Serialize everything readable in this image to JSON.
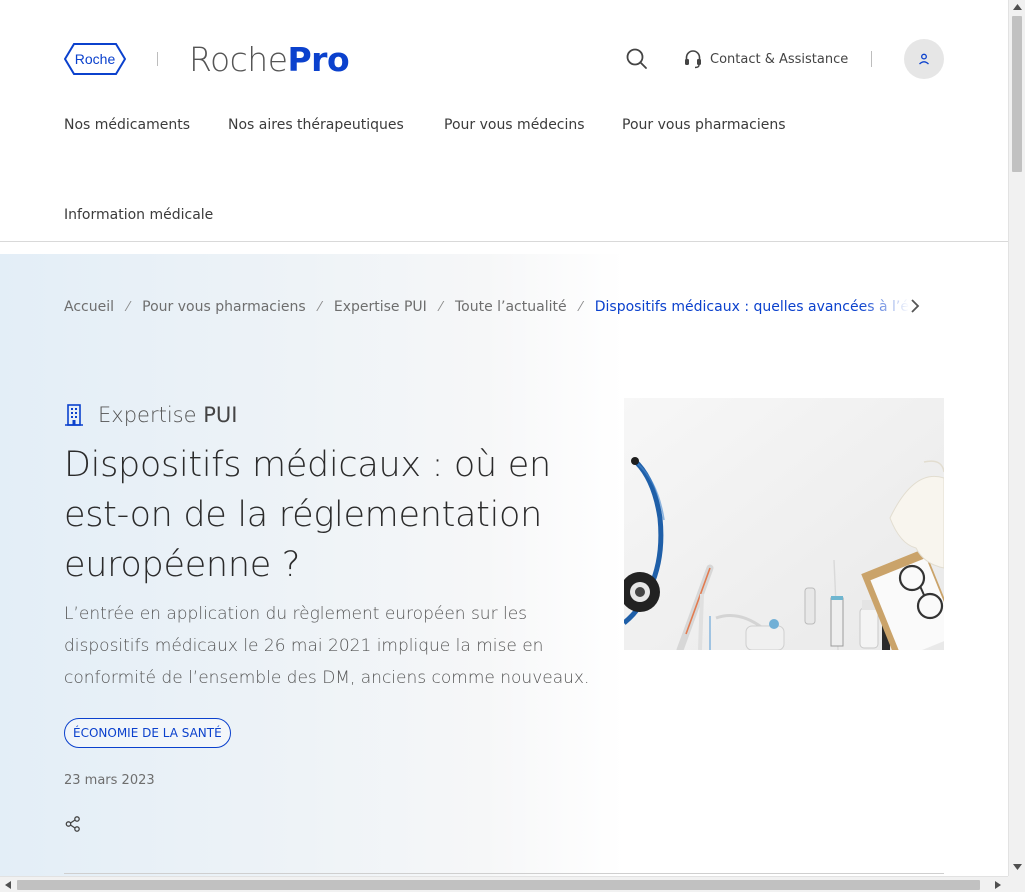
{
  "header": {
    "logo_text": "Roche",
    "brand_part1": "Roche",
    "brand_part2": "Pro",
    "search_icon": "search-icon",
    "contact_label": "Contact & Assistance",
    "contact_icon": "headset-icon",
    "account_icon": "user-icon"
  },
  "nav": {
    "items": [
      {
        "label": "Nos médicaments"
      },
      {
        "label": "Nos aires thérapeutiques"
      },
      {
        "label": "Pour vous médecins"
      },
      {
        "label": "Pour vous pharmaciens"
      },
      {
        "label": "Information médicale"
      }
    ]
  },
  "breadcrumb": {
    "items": [
      {
        "label": "Accueil"
      },
      {
        "label": "Pour vous pharmaciens"
      },
      {
        "label": "Expertise PUI"
      },
      {
        "label": "Toute l’actualité"
      }
    ],
    "separator": "⁄",
    "current": "Dispositifs médicaux : quelles avancées à l’échelle européenne ?"
  },
  "article": {
    "category_prefix": "Expertise",
    "category_bold": "PUI",
    "category_icon": "building-icon",
    "title": "Dispositifs médicaux : où en est-on de la réglementation européenne ?",
    "lead": "L’entrée en application du règlement européen sur les dispositifs médicaux le 26 mai 2021 implique la mise en conformité de l’ensemble des DM, anciens comme nouveaux.",
    "tag": "ÉCONOMIE DE LA SANTÉ",
    "date": "23 mars 2023",
    "share_icon": "share-icon"
  },
  "colors": {
    "accent": "#0b41cd",
    "text": "#2b2b2b",
    "muted": "#6e6e6e"
  }
}
